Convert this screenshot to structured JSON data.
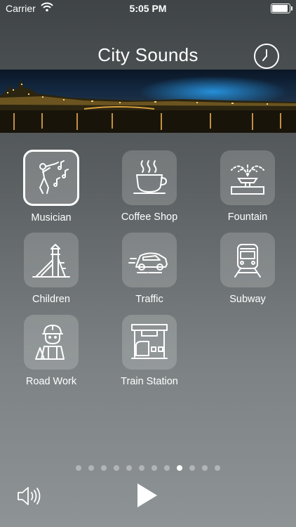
{
  "status_bar": {
    "carrier": "Carrier",
    "time": "5:05 PM"
  },
  "header": {
    "title": "City Sounds",
    "clock_icon": "clock-icon"
  },
  "banner": {
    "image": "city-night-panorama"
  },
  "sounds": [
    {
      "label": "Musician",
      "icon": "musician-icon",
      "selected": true
    },
    {
      "label": "Coffee Shop",
      "icon": "coffee-cup-icon",
      "selected": false
    },
    {
      "label": "Fountain",
      "icon": "fountain-icon",
      "selected": false
    },
    {
      "label": "Children",
      "icon": "playground-slide-icon",
      "selected": false
    },
    {
      "label": "Traffic",
      "icon": "car-icon",
      "selected": false
    },
    {
      "label": "Subway",
      "icon": "subway-train-icon",
      "selected": false
    },
    {
      "label": "Road Work",
      "icon": "construction-worker-icon",
      "selected": false
    },
    {
      "label": "Train Station",
      "icon": "train-station-icon",
      "selected": false
    }
  ],
  "pager": {
    "count": 12,
    "current": 9
  },
  "controls": {
    "volume_icon": "speaker-icon",
    "play_icon": "play-icon"
  },
  "colors": {
    "accent": "#ffffff",
    "tile_bg": "rgba(255,255,255,0.18)"
  }
}
